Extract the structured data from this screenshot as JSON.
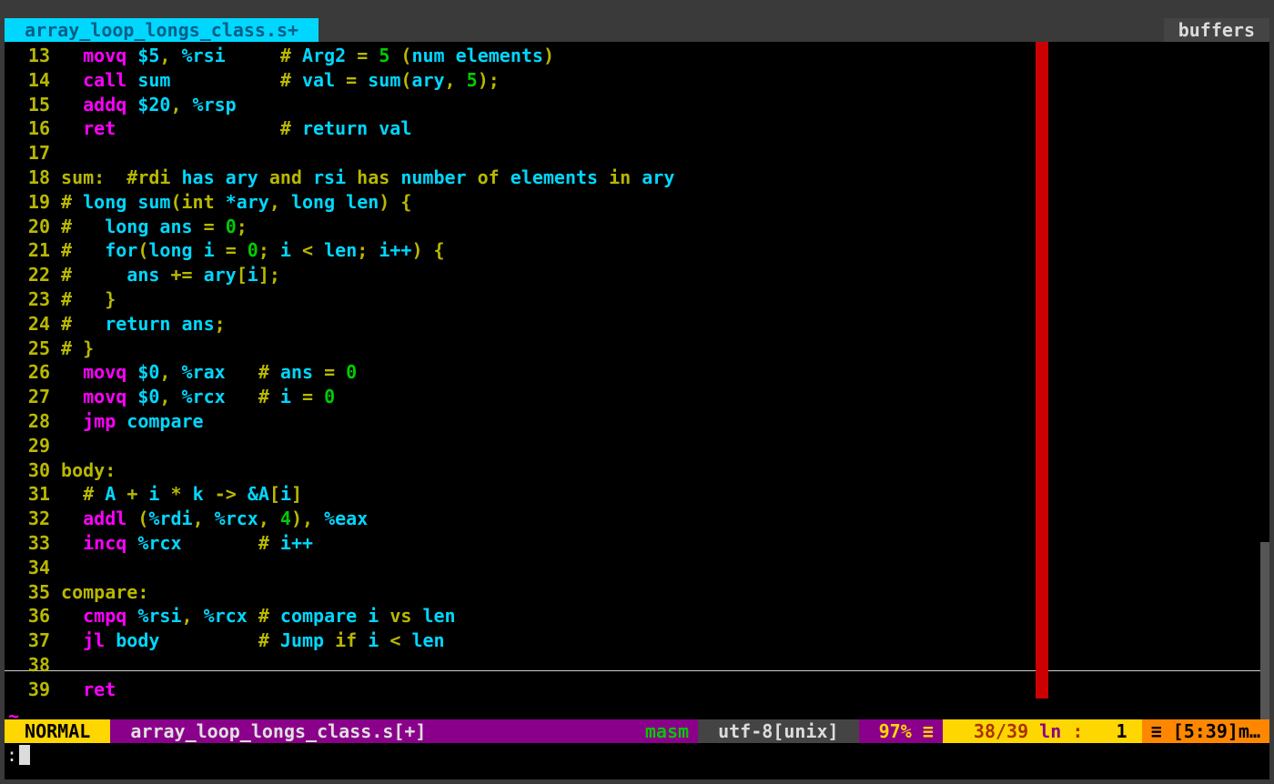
{
  "tab": {
    "title": " array_loop_longs_class.s+ ",
    "right": "buffers"
  },
  "lines": [
    {
      "n": "13",
      "segs": [
        [
          "wht",
          "   "
        ],
        [
          "mag",
          "movq"
        ],
        [
          "cyan",
          " $5"
        ],
        [
          "yel",
          ","
        ],
        [
          "cyan",
          " %rsi"
        ],
        [
          "wht",
          "     "
        ],
        [
          "yel",
          "# "
        ],
        [
          "cyan",
          "Arg2 "
        ],
        [
          "yel",
          "= "
        ],
        [
          "grn",
          "5 "
        ],
        [
          "yel",
          "("
        ],
        [
          "cyan",
          "num elements"
        ],
        [
          "yel",
          ")"
        ]
      ]
    },
    {
      "n": "14",
      "segs": [
        [
          "wht",
          "   "
        ],
        [
          "mag",
          "call"
        ],
        [
          "cyan",
          " sum"
        ],
        [
          "wht",
          "          "
        ],
        [
          "yel",
          "# "
        ],
        [
          "cyan",
          "val "
        ],
        [
          "yel",
          "= "
        ],
        [
          "cyan",
          "sum"
        ],
        [
          "yel",
          "("
        ],
        [
          "cyan",
          "ary"
        ],
        [
          "yel",
          ", "
        ],
        [
          "grn",
          "5"
        ],
        [
          "yel",
          ");"
        ]
      ]
    },
    {
      "n": "15",
      "segs": [
        [
          "wht",
          "   "
        ],
        [
          "mag",
          "addq"
        ],
        [
          "cyan",
          " $20"
        ],
        [
          "yel",
          ","
        ],
        [
          "cyan",
          " %rsp"
        ]
      ]
    },
    {
      "n": "16",
      "segs": [
        [
          "wht",
          "   "
        ],
        [
          "mag",
          "ret"
        ],
        [
          "wht",
          "               "
        ],
        [
          "yel",
          "# "
        ],
        [
          "cyan",
          "return val"
        ]
      ]
    },
    {
      "n": "17",
      "segs": [
        [
          "wht",
          " "
        ]
      ]
    },
    {
      "n": "18",
      "segs": [
        [
          "wht",
          " "
        ],
        [
          "yel",
          "sum:  #rdi "
        ],
        [
          "cyan",
          "has ary "
        ],
        [
          "yel",
          "and "
        ],
        [
          "cyan",
          "rsi "
        ],
        [
          "yel",
          "has "
        ],
        [
          "cyan",
          "number "
        ],
        [
          "yel",
          "of "
        ],
        [
          "cyan",
          "elements "
        ],
        [
          "yel",
          "in "
        ],
        [
          "cyan",
          "ary"
        ]
      ]
    },
    {
      "n": "19",
      "segs": [
        [
          "wht",
          " "
        ],
        [
          "yel",
          "# "
        ],
        [
          "cyan",
          "long sum"
        ],
        [
          "yel",
          "(int "
        ],
        [
          "cyan",
          "*ary"
        ],
        [
          "yel",
          ", "
        ],
        [
          "cyan",
          "long len"
        ],
        [
          "yel",
          ") {"
        ]
      ]
    },
    {
      "n": "20",
      "segs": [
        [
          "wht",
          " "
        ],
        [
          "yel",
          "#   "
        ],
        [
          "cyan",
          "long ans "
        ],
        [
          "yel",
          "= "
        ],
        [
          "grn",
          "0"
        ],
        [
          "yel",
          ";"
        ]
      ]
    },
    {
      "n": "21",
      "segs": [
        [
          "wht",
          " "
        ],
        [
          "yel",
          "#   "
        ],
        [
          "cyan",
          "for"
        ],
        [
          "yel",
          "("
        ],
        [
          "cyan",
          "long i "
        ],
        [
          "yel",
          "= "
        ],
        [
          "grn",
          "0"
        ],
        [
          "yel",
          "; "
        ],
        [
          "cyan",
          "i "
        ],
        [
          "yel",
          "< "
        ],
        [
          "cyan",
          "len"
        ],
        [
          "yel",
          "; "
        ],
        [
          "cyan",
          "i++"
        ],
        [
          "yel",
          ") {"
        ]
      ]
    },
    {
      "n": "22",
      "segs": [
        [
          "wht",
          " "
        ],
        [
          "yel",
          "#     "
        ],
        [
          "cyan",
          "ans "
        ],
        [
          "yel",
          "+= "
        ],
        [
          "cyan",
          "ary"
        ],
        [
          "yel",
          "["
        ],
        [
          "cyan",
          "i"
        ],
        [
          "yel",
          "];"
        ]
      ]
    },
    {
      "n": "23",
      "segs": [
        [
          "wht",
          " "
        ],
        [
          "yel",
          "#   }"
        ]
      ]
    },
    {
      "n": "24",
      "segs": [
        [
          "wht",
          " "
        ],
        [
          "yel",
          "#   "
        ],
        [
          "cyan",
          "return ans"
        ],
        [
          "yel",
          ";"
        ]
      ]
    },
    {
      "n": "25",
      "segs": [
        [
          "wht",
          " "
        ],
        [
          "yel",
          "# }"
        ]
      ]
    },
    {
      "n": "26",
      "segs": [
        [
          "wht",
          "   "
        ],
        [
          "mag",
          "movq"
        ],
        [
          "cyan",
          " $0"
        ],
        [
          "yel",
          ","
        ],
        [
          "cyan",
          " %rax"
        ],
        [
          "wht",
          "   "
        ],
        [
          "yel",
          "# "
        ],
        [
          "cyan",
          "ans "
        ],
        [
          "yel",
          "= "
        ],
        [
          "grn",
          "0"
        ]
      ]
    },
    {
      "n": "27",
      "segs": [
        [
          "wht",
          "   "
        ],
        [
          "mag",
          "movq"
        ],
        [
          "cyan",
          " $0"
        ],
        [
          "yel",
          ","
        ],
        [
          "cyan",
          " %rcx"
        ],
        [
          "wht",
          "   "
        ],
        [
          "yel",
          "# "
        ],
        [
          "cyan",
          "i "
        ],
        [
          "yel",
          "= "
        ],
        [
          "grn",
          "0"
        ]
      ]
    },
    {
      "n": "28",
      "segs": [
        [
          "wht",
          "   "
        ],
        [
          "mag",
          "jmp"
        ],
        [
          "cyan",
          " compare"
        ]
      ]
    },
    {
      "n": "29",
      "segs": [
        [
          "wht",
          " "
        ]
      ]
    },
    {
      "n": "30",
      "segs": [
        [
          "wht",
          " "
        ],
        [
          "yel",
          "body:"
        ]
      ]
    },
    {
      "n": "31",
      "segs": [
        [
          "wht",
          "   "
        ],
        [
          "yel",
          "# "
        ],
        [
          "cyan",
          "A "
        ],
        [
          "yel",
          "+ "
        ],
        [
          "cyan",
          "i "
        ],
        [
          "yel",
          "* "
        ],
        [
          "cyan",
          "k "
        ],
        [
          "yel",
          "-> "
        ],
        [
          "cyan",
          "&A"
        ],
        [
          "yel",
          "["
        ],
        [
          "cyan",
          "i"
        ],
        [
          "yel",
          "]"
        ]
      ]
    },
    {
      "n": "32",
      "segs": [
        [
          "wht",
          "   "
        ],
        [
          "mag",
          "addl"
        ],
        [
          "cyan",
          " "
        ],
        [
          "yel",
          "("
        ],
        [
          "cyan",
          "%rdi"
        ],
        [
          "yel",
          ","
        ],
        [
          "cyan",
          " %rcx"
        ],
        [
          "yel",
          ","
        ],
        [
          "cyan",
          " "
        ],
        [
          "grn",
          "4"
        ],
        [
          "yel",
          "),"
        ],
        [
          "cyan",
          " %eax"
        ]
      ]
    },
    {
      "n": "33",
      "segs": [
        [
          "wht",
          "   "
        ],
        [
          "mag",
          "incq"
        ],
        [
          "cyan",
          " %rcx"
        ],
        [
          "wht",
          "       "
        ],
        [
          "yel",
          "# "
        ],
        [
          "cyan",
          "i++"
        ]
      ]
    },
    {
      "n": "34",
      "segs": [
        [
          "wht",
          " "
        ]
      ]
    },
    {
      "n": "35",
      "segs": [
        [
          "wht",
          " "
        ],
        [
          "yel",
          "compare:"
        ]
      ]
    },
    {
      "n": "36",
      "segs": [
        [
          "wht",
          "   "
        ],
        [
          "mag",
          "cmpq"
        ],
        [
          "cyan",
          " %rsi"
        ],
        [
          "yel",
          ","
        ],
        [
          "cyan",
          " %rcx "
        ],
        [
          "yel",
          "# "
        ],
        [
          "cyan",
          "compare i "
        ],
        [
          "yel",
          "vs "
        ],
        [
          "cyan",
          "len"
        ]
      ]
    },
    {
      "n": "37",
      "segs": [
        [
          "wht",
          "   "
        ],
        [
          "mag",
          "jl"
        ],
        [
          "cyan",
          " body"
        ],
        [
          "wht",
          "         "
        ],
        [
          "yel",
          "# "
        ],
        [
          "cyan",
          "Jump "
        ],
        [
          "yel",
          "if "
        ],
        [
          "cyan",
          "i "
        ],
        [
          "yel",
          "< "
        ],
        [
          "cyan",
          "len"
        ]
      ]
    },
    {
      "n": "38",
      "segs": [
        [
          "wht",
          " "
        ]
      ]
    },
    {
      "n": "39",
      "segs": [
        [
          "wht",
          "   "
        ],
        [
          "mag",
          "ret"
        ]
      ]
    }
  ],
  "status": {
    "mode": " NORMAL ",
    "file": " array_loop_longs_class.s[+] ",
    "ft": "masm",
    "enc": " utf-8[unix] ",
    "pct": " 97% ",
    "pos": "  38/39",
    "lnlab": " ln ",
    "colsep": ": ",
    "col": "  1 ",
    "time": "[5:39]m…"
  },
  "cmd": ":"
}
